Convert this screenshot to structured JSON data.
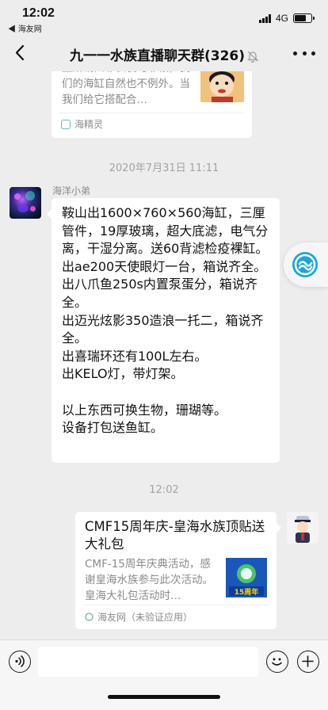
{
  "status_bar": {
    "time": "12:02",
    "back_app": "◀ 海友网",
    "network": "4G",
    "battery_level": 0.7
  },
  "nav": {
    "title": "九一一水族直播聊天群(326)",
    "muted": true
  },
  "messages": {
    "top_card": {
      "description": "止所谓人靠衣装马靠鞍，我们的海缸自然也不例外。当我们给它搭配合…",
      "source": "海精灵"
    },
    "timestamp_1": "2020年7月31日 11:11",
    "text_message": {
      "sender": "海洋小弟",
      "text": "鞍山出1600×760×560海缸，三厘管件，19厚玻璃，超大底滤，电气分离，干湿分离。送60背滤检疫裸缸。\n出ae200天使眼灯一台，箱说齐全。\n出八爪鱼250s内置泵蛋分，箱说齐全。\n出迈光炫影350造浪一托二，箱说齐全。\n出喜瑞环还有100L左右。\n出KELO灯，带灯架。\n\n以上东西可换生物，珊瑚等。\n设备打包送鱼缸。"
    },
    "timestamp_2": "12:02",
    "share_card": {
      "title": "CMF15周年庆-皇海水族顶贴送大礼包",
      "description": "CMF-15周年庆典活动，感谢皇海水族参与此次活动。皇海大礼包活动时…",
      "thumb_label": "15周年",
      "source": "海友网（未验证应用）"
    }
  },
  "input_bar": {
    "placeholder": ""
  },
  "colors": {
    "background": "#ededed",
    "bubble": "#ffffff",
    "meta_text": "#a3a3a3",
    "link_icon": "#1aa6d6"
  }
}
